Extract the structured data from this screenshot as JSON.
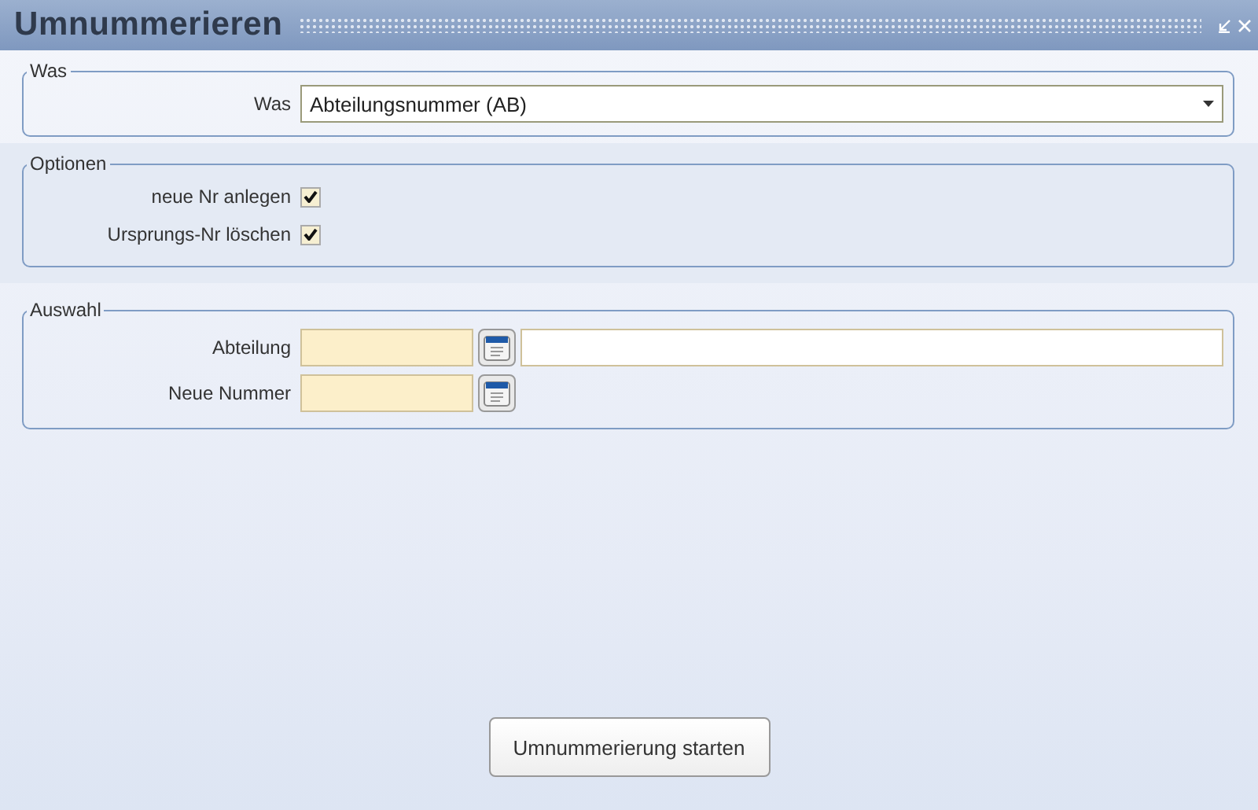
{
  "window": {
    "title": "Umnummerieren"
  },
  "was": {
    "legend": "Was",
    "label": "Was",
    "value": "Abteilungsnummer (AB)"
  },
  "optionen": {
    "legend": "Optionen",
    "items": [
      {
        "label": "neue Nr anlegen",
        "checked": true
      },
      {
        "label": "Ursprungs-Nr löschen",
        "checked": true
      }
    ]
  },
  "auswahl": {
    "legend": "Auswahl",
    "fields": [
      {
        "label": "Abteilung",
        "has_description": true
      },
      {
        "label": "Neue Nummer",
        "has_description": false
      }
    ]
  },
  "buttons": [
    "Umnummerierung starten"
  ]
}
